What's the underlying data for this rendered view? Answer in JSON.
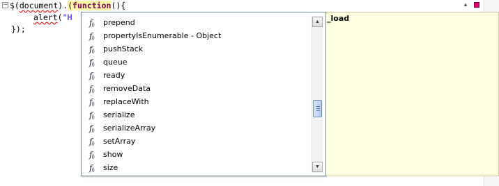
{
  "editor": {
    "line1": {
      "part1": "$(",
      "part2": "document",
      "part3": ").",
      "part4": "(",
      "keyword": "function",
      "part5": "(){"
    },
    "line2": {
      "call": "alert",
      "paren": "(",
      "string_start": "\"H"
    },
    "line3": {
      "close": "});"
    },
    "fold_symbol": "−"
  },
  "assist": {
    "icon_letter": "f",
    "icon_sub": "()",
    "items": [
      {
        "label": "prepend"
      },
      {
        "label": "propertyIsEnumerable - Object"
      },
      {
        "label": "pushStack"
      },
      {
        "label": "queue"
      },
      {
        "label": "ready"
      },
      {
        "label": "removeData"
      },
      {
        "label": "replaceWith"
      },
      {
        "label": "serialize"
      },
      {
        "label": "serializeArray"
      },
      {
        "label": "setArray"
      },
      {
        "label": "show"
      },
      {
        "label": "size"
      }
    ],
    "scroll_position": 0.62
  },
  "info": {
    "text": "_load"
  },
  "colors": {
    "keyword": "#7f0055",
    "string": "#2a00ff",
    "info_background": "#ffffe1",
    "marker": "#d4006b"
  },
  "icons": {
    "fold": "collapse-minus-icon",
    "function": "function-icon",
    "scroll_up": "up-arrow-icon",
    "scroll_down": "down-arrow-icon"
  }
}
